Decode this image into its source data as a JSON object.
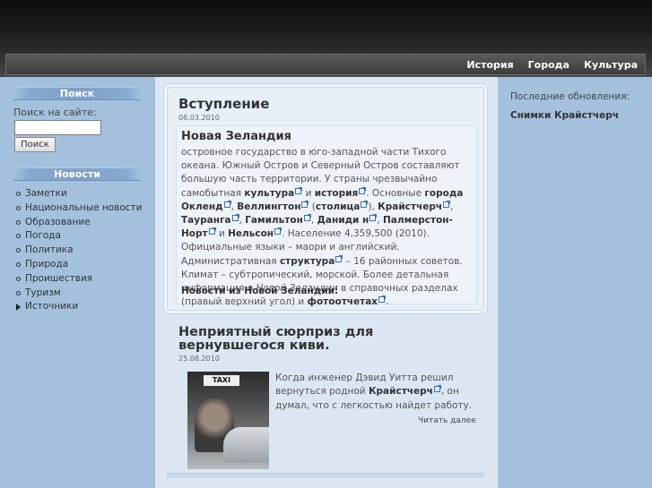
{
  "nav": {
    "items": [
      "История",
      "Города",
      "Культура"
    ]
  },
  "sidebar": {
    "search_heading": "Поиск",
    "search_label": "Поиск на сайте:",
    "search_value": "",
    "search_button": "Поиск",
    "news_heading": "Новости",
    "news_items": [
      "Заметки",
      "Национальные новости",
      "Образование",
      "Погода",
      "Политика",
      "Природа",
      "Проишествия",
      "Туризм",
      "Источники"
    ]
  },
  "post1": {
    "title": "Вступление",
    "date": "08.03.2010",
    "subtitle": "Новая Зеландия",
    "text_1": "островное государство в юго-западной части Тихого океана. Южный Остров и Северный Остров составляют большую часть территории. У страны чрезвычайно самобытная ",
    "link_culture": "культура",
    "and": " и ",
    "link_history": "история",
    "text_2": ". Основные ",
    "link_cities": "города",
    "link_auckland": "Окленд",
    "link_wellington": "Веллингтон",
    "link_capital": "столица",
    "link_christchurch": "Крайстчерч",
    "link_tauranga": "Тауранга",
    "link_hamilton": "Гамильтон",
    "link_dunedin": "Даниди н",
    "link_palmerston": "Палмерстон-Норт",
    "link_nelson": "Нельсон",
    "text_3": ". Население 4,359,500 (2010). Официальные языки – маори и английский. Административная ",
    "link_structure": "структура",
    "text_4": " – 16 районных советов. Климат – субтропический, морской. Более детальная информация о ",
    "italic_nz": "Новой Зеландии",
    "text_5": " в справочных разделах (правый верхний угол) и ",
    "link_photo": "фотоотчетах",
    "news_from": "Новости из Новой Зеландии:"
  },
  "post2": {
    "title": "Неприятный сюрприз для вернувшегося киви.",
    "date": "25.08.2010",
    "image_sign": "TAXI",
    "text_1": "Когда инженер Дэвид Уитта решил вернуться родной ",
    "link_christchurch": "Крайстчерч",
    "text_2": ", он думал, что с легкостью найдет работу.",
    "read_more": "Читать далее"
  },
  "right": {
    "recent_label": "Последние обновления:",
    "recent_link": "Снимки Крайстчерч"
  }
}
